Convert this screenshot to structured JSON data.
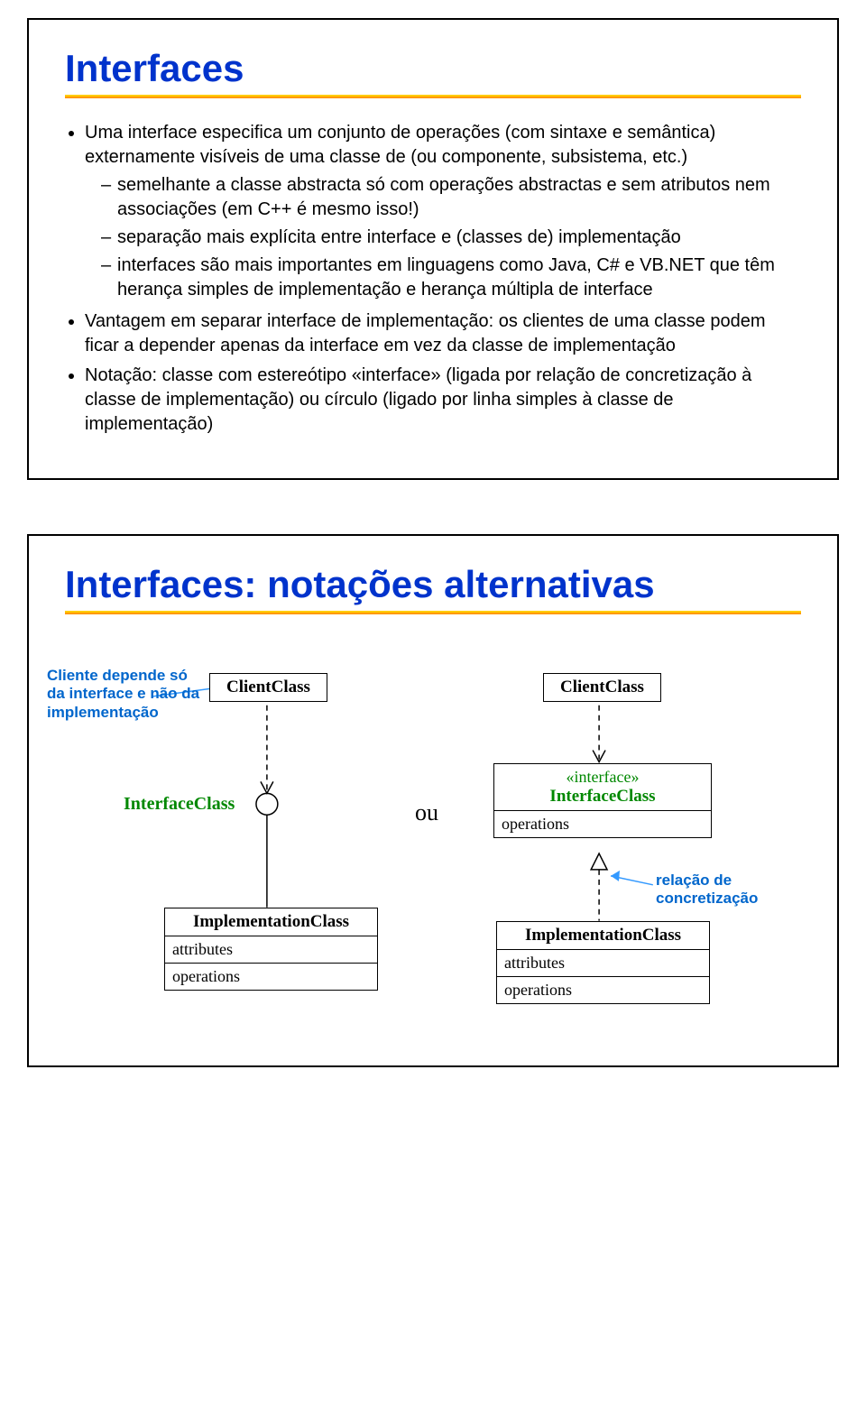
{
  "slide1": {
    "title": "Interfaces",
    "bullets": {
      "b1": "Uma interface especifica um conjunto de operações (com sintaxe e semântica) externamente visíveis de uma classe de (ou componente, subsistema, etc.)",
      "b1a": "semelhante a classe abstracta só com operações abstractas e sem atributos nem associações (em C++ é mesmo isso!)",
      "b1b": "separação mais explícita entre interface e (classes de) implementação",
      "b1c": "interfaces são mais importantes em linguagens como Java, C# e VB.NET que têm herança simples de implementação e herança múltipla de interface",
      "b2": "Vantagem em separar interface de implementação: os clientes de uma classe podem ficar a depender apenas da interface em vez da classe de implementação",
      "b3": "Notação: classe com estereótipo «interface» (ligada por relação de concretização à classe de implementação) ou círculo (ligado por linha simples à classe de implementação)"
    }
  },
  "slide2": {
    "title": "Interfaces: notações alternativas",
    "labels": {
      "cliente_note": "Cliente depende só da interface e não da implementação",
      "relacao_note": "relação de concretização",
      "interface_class": "InterfaceClass",
      "ou": "ou"
    },
    "boxes": {
      "client1": "ClientClass",
      "impl1": "ImplementationClass",
      "attributes": "attributes",
      "operations": "operations",
      "client2": "ClientClass",
      "stereotype": "«interface»",
      "interface2": "InterfaceClass",
      "impl2": "ImplementationClass"
    }
  }
}
